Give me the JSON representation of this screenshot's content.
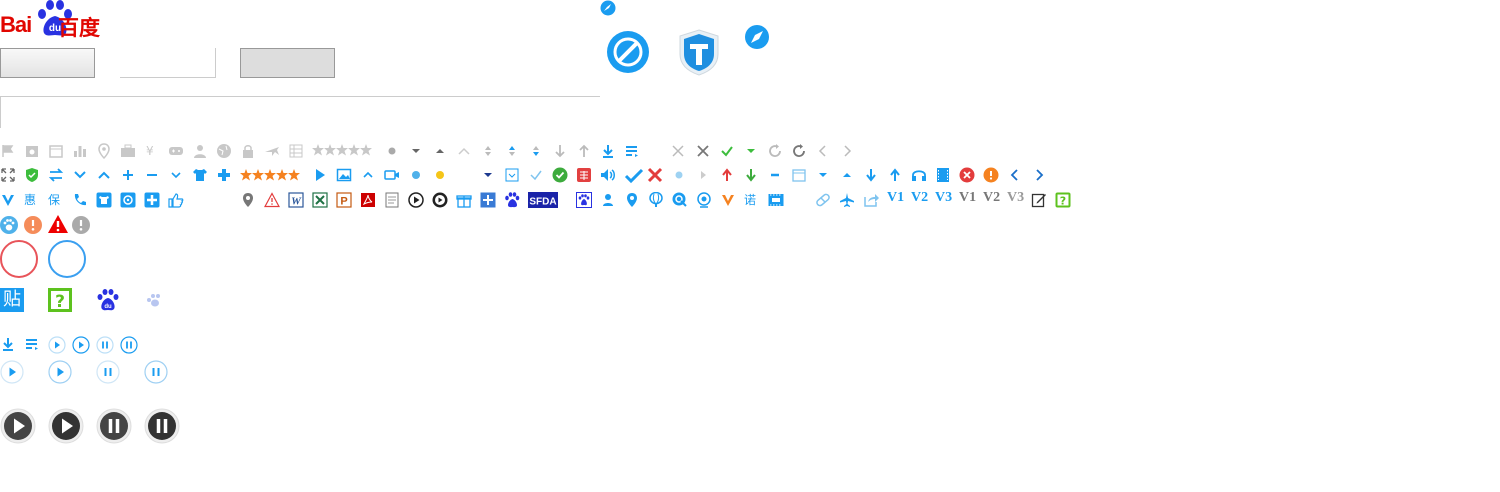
{
  "logo": {
    "latin": "Bai",
    "du": "du",
    "cjk": "百度"
  },
  "text_icons": {
    "hui": "惠",
    "bao": "保",
    "nuo": "诺",
    "tie": "贴",
    "sfda": "SFDA",
    "v1": "V1",
    "v2": "V2",
    "v3": "V3"
  },
  "colors": {
    "brand_red": "#e10601",
    "accent_blue": "#1a9cf0",
    "gray": "#b9b9b9"
  }
}
